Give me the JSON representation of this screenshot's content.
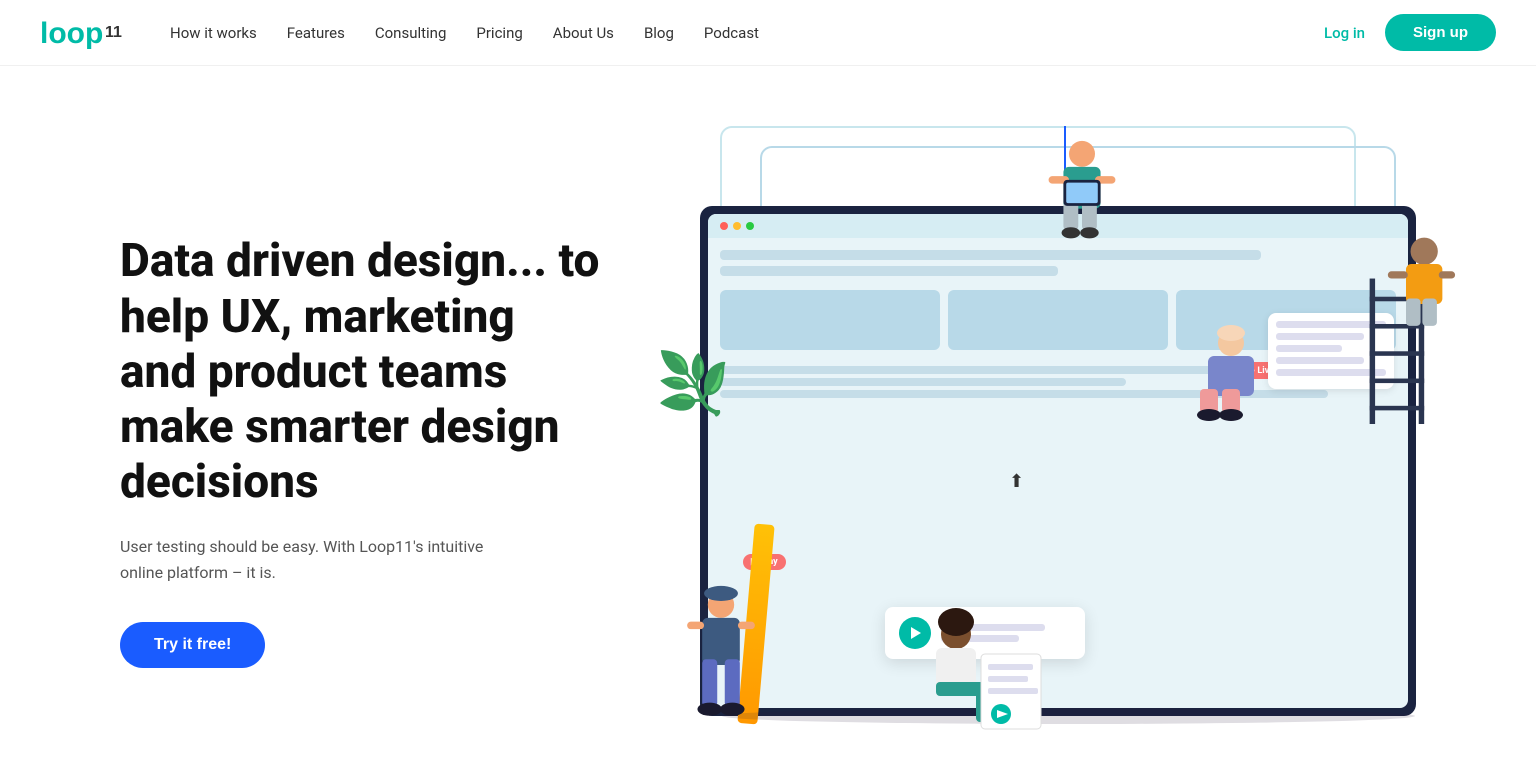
{
  "brand": {
    "name": "Loop11",
    "logo_text": "loop11"
  },
  "nav": {
    "links": [
      {
        "id": "how-it-works",
        "label": "How it works"
      },
      {
        "id": "features",
        "label": "Features"
      },
      {
        "id": "consulting",
        "label": "Consulting"
      },
      {
        "id": "pricing",
        "label": "Pricing"
      },
      {
        "id": "about-us",
        "label": "About Us"
      },
      {
        "id": "blog",
        "label": "Blog"
      },
      {
        "id": "podcast",
        "label": "Podcast"
      }
    ],
    "login_label": "Log in",
    "signup_label": "Sign up"
  },
  "hero": {
    "title": "Data driven design... to help UX, marketing and product teams make smarter design decisions",
    "subtitle": "User testing should be easy. With Loop11's intuitive online platform – it is.",
    "cta_label": "Try it free!",
    "live_badge": "● Live",
    "play_badge": "▶ Play"
  },
  "colors": {
    "teal": "#00bba7",
    "blue": "#1a5cff",
    "dark_navy": "#1a2340",
    "light_blue_bg": "#e8f4f8"
  }
}
